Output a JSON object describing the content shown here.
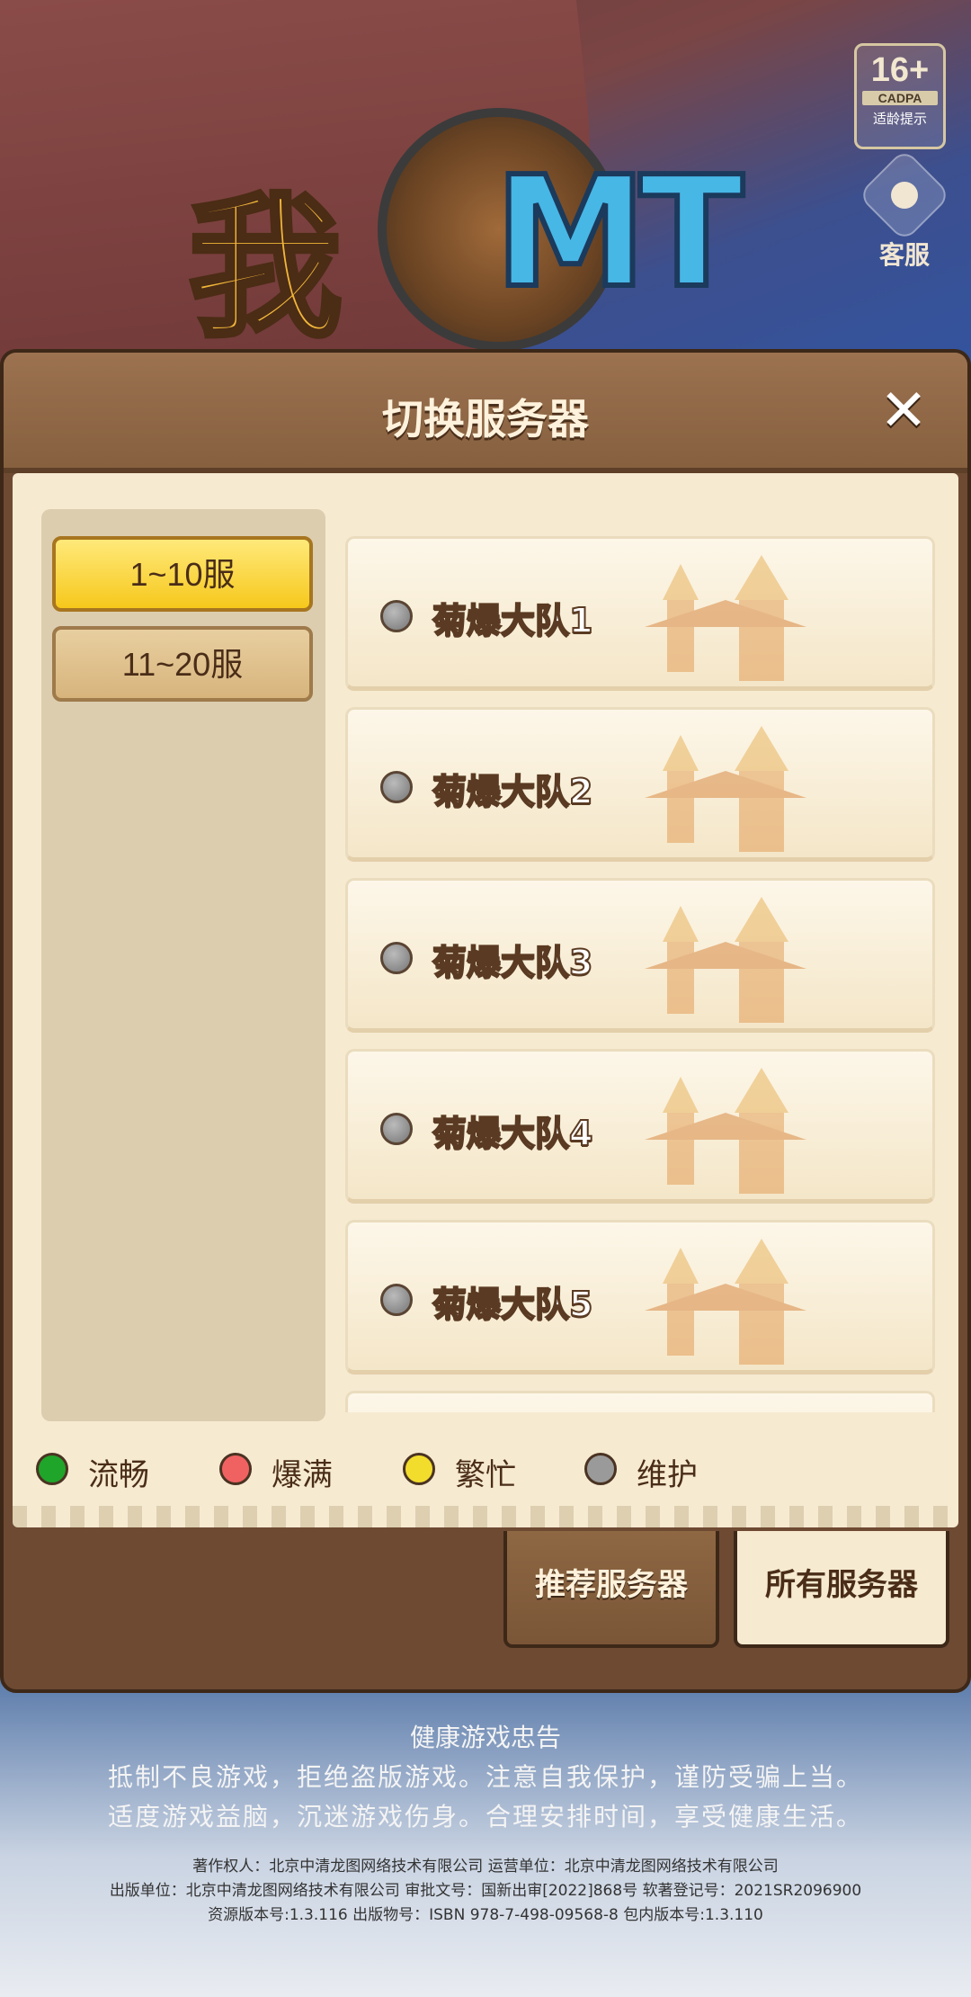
{
  "dialog": {
    "title": "切换服务器",
    "close_symbol": "✕"
  },
  "age_rating": {
    "age": "16+",
    "org": "CADPA",
    "tip": "适龄提示"
  },
  "customer_service": {
    "label": "客服",
    "icon": "headset-icon"
  },
  "server_ranges": [
    {
      "label": "1~10服",
      "active": true
    },
    {
      "label": "11~20服",
      "active": false
    }
  ],
  "servers": [
    {
      "name": "菊爆大队1",
      "status": "维护",
      "status_color": "#9a9a9a"
    },
    {
      "name": "菊爆大队2",
      "status": "维护",
      "status_color": "#9a9a9a"
    },
    {
      "name": "菊爆大队3",
      "status": "维护",
      "status_color": "#9a9a9a"
    },
    {
      "name": "菊爆大队4",
      "status": "维护",
      "status_color": "#9a9a9a"
    },
    {
      "name": "菊爆大队5",
      "status": "维护",
      "status_color": "#9a9a9a"
    }
  ],
  "legend": [
    {
      "label": "流畅",
      "color": "#1fa52a"
    },
    {
      "label": "爆满",
      "color": "#f06262"
    },
    {
      "label": "繁忙",
      "color": "#f3dd2c"
    },
    {
      "label": "维护",
      "color": "#9a9a9a"
    }
  ],
  "tabs": {
    "recommended": "推荐服务器",
    "all": "所有服务器"
  },
  "footer": {
    "title": "健康游戏忠告",
    "line1": "抵制不良游戏，拒绝盗版游戏。注意自我保护，谨防受骗上当。",
    "line2": "适度游戏益脑，沉迷游戏伤身。合理安排时间，享受健康生活。",
    "info1": "著作权人：北京中清龙图网络技术有限公司 运营单位：北京中清龙图网络技术有限公司",
    "info2": "出版单位：北京中清龙图网络技术有限公司    审批文号：国新出审[2022]868号  软著登记号：2021SR2096900",
    "info3": "资源版本号:1.3.116          出版物号：ISBN 978-7-498-09568-8          包内版本号:1.3.110"
  },
  "colors": {
    "panel_brown": "#6e4a33",
    "parchment": "#f6ead1",
    "active_yellow": "#f6c81c"
  }
}
